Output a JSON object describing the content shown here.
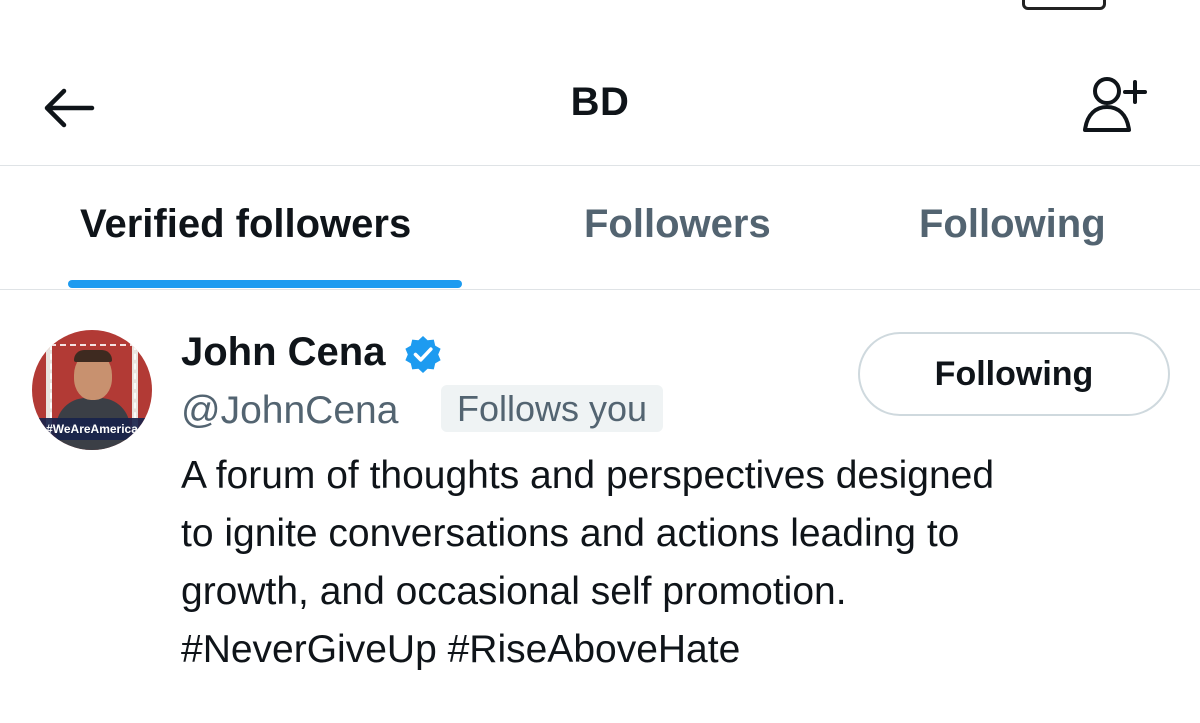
{
  "header": {
    "title": "BD",
    "back_icon": "arrow-left-icon",
    "add_user_icon": "add-user-icon"
  },
  "tabs": [
    {
      "label": "Verified followers",
      "active": true
    },
    {
      "label": "Followers",
      "active": false
    },
    {
      "label": "Following",
      "active": false
    }
  ],
  "user": {
    "display_name": "John Cena",
    "verified": true,
    "handle": "@JohnCena",
    "follows_you_label": "Follows you",
    "follow_button_label": "Following",
    "avatar_banner_text": "#WeAreAmerica",
    "bio_lines": [
      "A forum of thoughts and perspectives designed",
      "to ignite conversations and actions leading to",
      "growth, and occasional self promotion.",
      "#NeverGiveUp #RiseAboveHate"
    ]
  },
  "colors": {
    "accent": "#1d9bf0",
    "text_primary": "#0f1419",
    "text_secondary": "#536471",
    "divider": "#dfe3e6",
    "badge_bg": "#eff3f4"
  }
}
